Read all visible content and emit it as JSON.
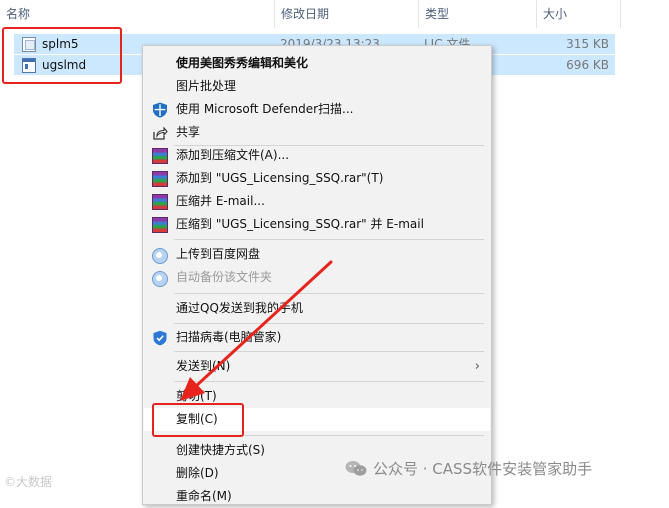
{
  "columns": {
    "name": "名称",
    "date": "修改日期",
    "type": "类型",
    "size": "大小"
  },
  "files": [
    {
      "name": "splm5",
      "date": "2019/3/23 13:23",
      "type": "LIC 文件",
      "size": "315 KB",
      "icon": "document-file-icon"
    },
    {
      "name": "ugslmd",
      "date": "",
      "type": "",
      "size": "696 KB",
      "icon": "application-file-icon"
    }
  ],
  "context_menu": {
    "meitu_edit": "使用美图秀秀编辑和美化",
    "batch_image": "图片批处理",
    "defender_scan": "使用 Microsoft Defender扫描...",
    "share": "共享",
    "add_archive": "添加到压缩文件(A)...",
    "add_to_rar": "添加到 \"UGS_Licensing_SSQ.rar\"(T)",
    "compress_email": "压缩并 E-mail...",
    "compress_rar_email": "压缩到 \"UGS_Licensing_SSQ.rar\" 并 E-mail",
    "upload_baidu": "上传到百度网盘",
    "auto_backup": "自动备份该文件夹",
    "send_qq": "通过QQ发送到我的手机",
    "scan_virus": "扫描病毒(电脑管家)",
    "send_to": "发送到(N)",
    "cut": "剪切(T)",
    "copy": "复制(C)",
    "create_shortcut": "创建快捷方式(S)",
    "delete": "删除(D)",
    "rename": "重命名(M)"
  },
  "watermarks": {
    "left": "©大数据",
    "right": "公众号 · CASS软件安装管家助手"
  },
  "colors": {
    "selection": "#cce8ff",
    "highlight": "#e8231c",
    "menu_bg": "#f2f2f2"
  }
}
